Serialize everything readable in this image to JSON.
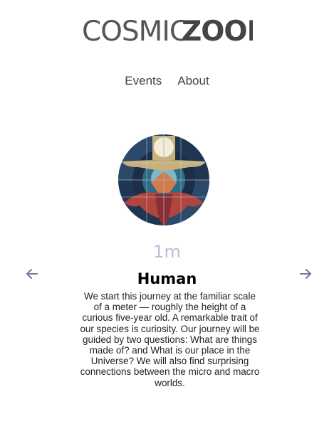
{
  "logo": {
    "text_light": "COSMIC",
    "text_bold": "ZOOM"
  },
  "nav": {
    "items": [
      {
        "label": "Events"
      },
      {
        "label": "About"
      }
    ]
  },
  "stage": {
    "image_icon": "human-artwork",
    "scale_label": "1m",
    "title": "Human",
    "description": "We start this journey at the familiar scale of a meter — roughly the height of a curious five-year old. A remarkable trait of our species is curiosity. Our journey will be guided by two questions: What are things made of? and What is our place in the Universe? We will also find surprising connections between the micro and macro worlds.",
    "prev_icon": "arrow-left-icon",
    "next_icon": "arrow-right-icon"
  },
  "colors": {
    "accent_arrow": "#6b7a9b",
    "scale_text": "#b5bfd6",
    "art_navy": "#1f3552",
    "art_teal": "#2e6b84",
    "art_red": "#b0443f",
    "art_gold": "#c7b07a",
    "art_cream": "#f3ecd6"
  }
}
